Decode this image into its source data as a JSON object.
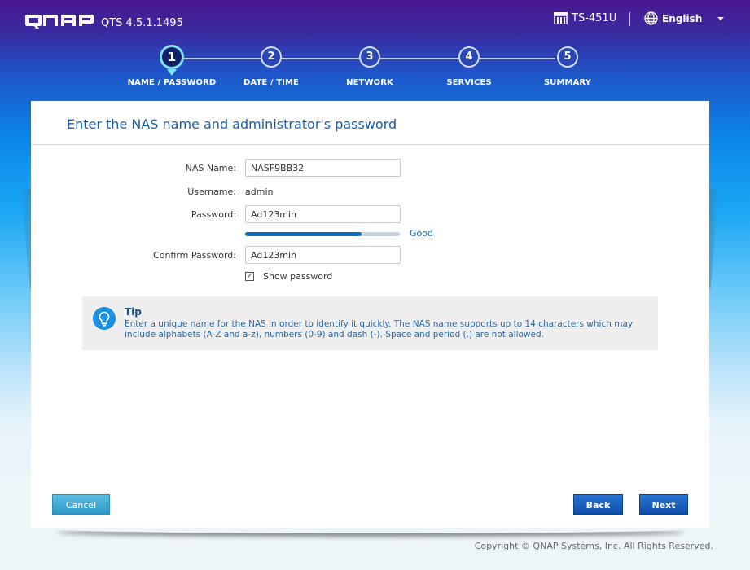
{
  "header": {
    "brand": "QNAP",
    "version": "QTS 4.5.1.1495",
    "device_icon": "nas-device-icon",
    "device_name": "TS-451U",
    "language_icon": "globe-icon",
    "language": "English"
  },
  "steps": [
    {
      "number": "1",
      "label": "NAME / PASSWORD",
      "active": true
    },
    {
      "number": "2",
      "label": "DATE / TIME",
      "active": false
    },
    {
      "number": "3",
      "label": "NETWORK",
      "active": false
    },
    {
      "number": "4",
      "label": "SERVICES",
      "active": false
    },
    {
      "number": "5",
      "label": "SUMMARY",
      "active": false
    }
  ],
  "card": {
    "title": "Enter the NAS name and administrator's password",
    "form": {
      "nas_name_label": "NAS Name:",
      "nas_name_value": "NASF9BB32",
      "username_label": "Username:",
      "username_value": "admin",
      "password_label": "Password:",
      "password_value": "Ad123min",
      "strength_percent": 75,
      "strength_text": "Good",
      "confirm_label": "Confirm Password:",
      "confirm_value": "Ad123min",
      "show_password_checked": true,
      "show_password_label": "Show password"
    },
    "tip": {
      "icon": "lightbulb-icon",
      "title": "Tip",
      "text": "Enter a unique name for the NAS in order to identify it quickly. The NAS name supports up to 14 characters which may include alphabets (A-Z and a-z), numbers (0-9) and dash (-). Space and period (.) are not allowed."
    },
    "buttons": {
      "cancel": "Cancel",
      "back": "Back",
      "next": "Next"
    }
  },
  "colors": {
    "accent": "#1a5fa6",
    "strength": "#0a6cc2",
    "active_step_ring": "#7fe3f7"
  },
  "footer": {
    "copyright": "Copyright © QNAP Systems, Inc. All Rights Reserved."
  }
}
